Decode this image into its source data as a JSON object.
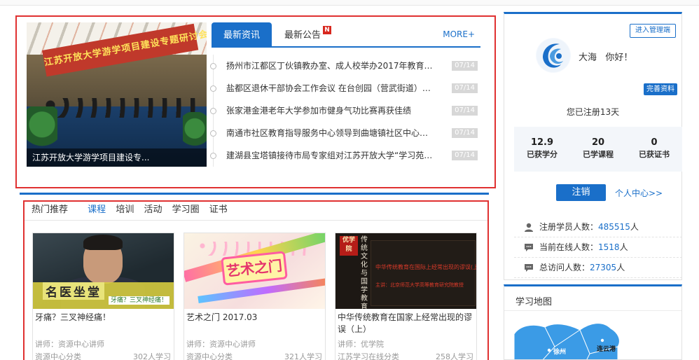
{
  "news": {
    "slide_banner": "江苏开放大学游学项目建设专题研讨会",
    "slide_caption": "江苏开放大学游学项目建设专...",
    "tabs": [
      {
        "label": "最新资讯"
      },
      {
        "label": "最新公告",
        "badge": "N"
      }
    ],
    "more_label": "MORE+",
    "items": [
      {
        "title": "扬州市江都区丁伙镇教办室、成人校举办2017年教育管理...",
        "date": "07/14"
      },
      {
        "title": "盐都区退休干部协会工作会议 在台创园（营武街道）老年活...",
        "date": "07/14"
      },
      {
        "title": "张家港金港老年大学参加市健身气功比赛再获佳绩",
        "date": "07/14"
      },
      {
        "title": "南通市社区教育指导服务中心领导到曲塘镇社区中心指导工作",
        "date": "07/14"
      },
      {
        "title": "建湖县宝塔镇接待市局专家组对江苏开放大学“学习苑”创...",
        "date": "07/14"
      }
    ]
  },
  "courses": {
    "tabs": [
      "热门推荐",
      "课程",
      "培训",
      "活动",
      "学习圈",
      "证书"
    ],
    "active_tab": "课程",
    "items": [
      {
        "title": "牙痛？三叉神经痛！",
        "teacher": "讲师：资源中心讲师",
        "category": "资源中心分类",
        "count": "302人学习",
        "thumb_text": "名医坐堂",
        "thumb_sub": "牙痛？三叉神经痛！"
      },
      {
        "title": "艺术之门 2017.03",
        "teacher": "讲师：资源中心讲师",
        "category": "资源中心分类",
        "count": "321人学习",
        "thumb_text": "艺术之门"
      },
      {
        "title": "中华传统教育在国家上经常出现的谬误（上）",
        "teacher": "讲师：优学院",
        "category": "江苏学习在线分类",
        "count": "258人学习",
        "thumb_tag": "优学院",
        "thumb_vertical": "传统文化与国学教育",
        "thumb_line1": "中华传统教育在国际上经常出现的谬误(上)",
        "thumb_line2": "主讲：北京师范大学高等教育研究院教授"
      }
    ]
  },
  "user": {
    "admin_button": "进入管理端",
    "name": "大海",
    "greeting": "你好！",
    "profile_button": "完善资料",
    "registered_text": "您已注册13天",
    "stats": [
      {
        "value": "12.9",
        "label": "已获学分"
      },
      {
        "value": "20",
        "label": "已学课程"
      },
      {
        "value": "0",
        "label": "已获证书"
      }
    ],
    "logout_button": "注销",
    "center_link": "个人中心>>"
  },
  "site_stats": [
    {
      "label": "注册学员人数：",
      "value": "485515",
      "unit": "人",
      "icon": "user-icon"
    },
    {
      "label": "当前在线人数：",
      "value": "1518",
      "unit": "人",
      "icon": "chat-icon"
    },
    {
      "label": "总访问人数：",
      "value": "27305",
      "unit": "人",
      "icon": "chat-icon"
    }
  ],
  "map": {
    "title": "学习地图",
    "cities": [
      "徐州",
      "连云港"
    ]
  },
  "colors": {
    "accent": "#1a6fc9",
    "highlight_border": "#e03131"
  }
}
